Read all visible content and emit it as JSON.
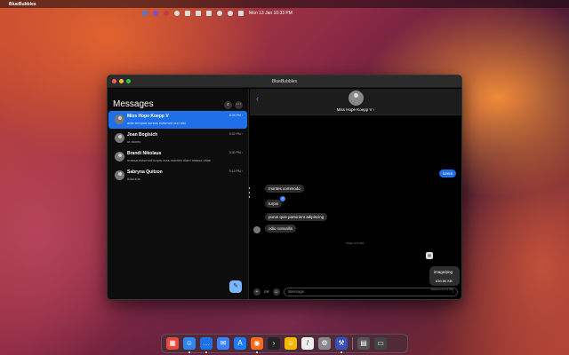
{
  "menubar": {
    "app_name": "BlueBubbles",
    "datetime": "Mon 13 Jan  10:33 PM"
  },
  "window": {
    "title": "BlueBubbles"
  },
  "sidebar": {
    "title": "Messages",
    "conversations": [
      {
        "name": "Miss Hope Koepp V",
        "time": "8:39 PM ›",
        "preview": "ante tempus cursus euismod orci nisi",
        "active": true
      },
      {
        "name": "Joan Bogisich",
        "time": "5:32 PM ›",
        "preview": "ut donec",
        "active": false
      },
      {
        "name": "Brandt Nikolaus",
        "time": "5:30 PM ›",
        "preview": "massa euismod turpis cras montes diam massa vitae",
        "active": false
      },
      {
        "name": "Sabryna Quitzon",
        "time": "5:19 PM ›",
        "preview": "ridiculus",
        "active": false
      }
    ]
  },
  "conversation": {
    "contact_name": "Miss Hope Koepp V ›",
    "messages": [
      {
        "text": "lorem",
        "direction": "out"
      },
      {
        "text": "montes commodo",
        "direction": "in"
      },
      {
        "text": "turpis",
        "direction": "in"
      },
      {
        "text": "purus quis parturient adipiscing",
        "direction": "in"
      },
      {
        "text": "odio convallis",
        "direction": "in"
      }
    ],
    "day_stamp": "Today 9:47 PM",
    "attachment": {
      "type": "image/png",
      "size": "639.86 KB"
    },
    "delivered": "Delivered 9:47 PM",
    "compose_placeholder": "Message",
    "gif_label": "GIF"
  }
}
